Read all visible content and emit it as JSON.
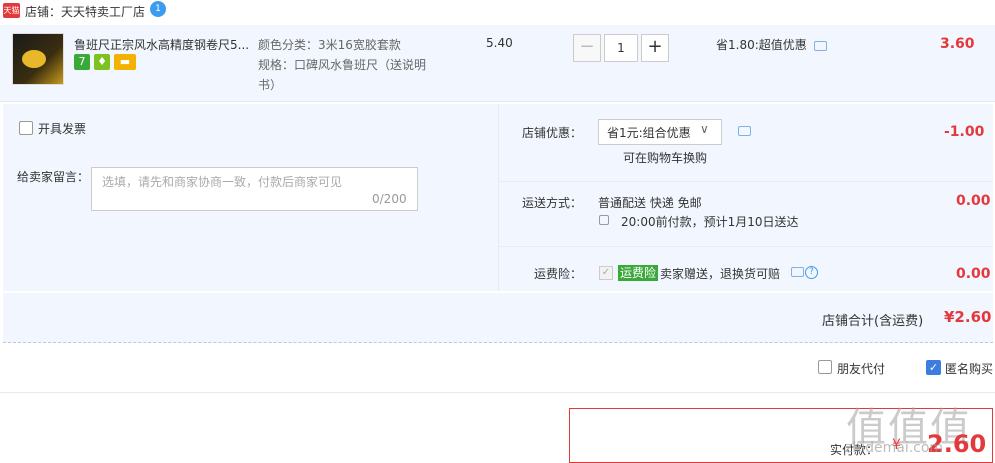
{
  "shop": {
    "logo_text": "天猫",
    "label": "店铺：天天特卖工厂店",
    "badge": "1"
  },
  "item": {
    "title": "鲁班尺正宗风水高精度钢卷尺5...",
    "tags": [
      "7",
      "♦",
      "▬"
    ],
    "attr_color": "颜色分类：3米16宽胶套款",
    "attr_spec_1": "规格：口碑风水鲁班尺（送说明",
    "attr_spec_2": "书）",
    "unit_price": "5.40",
    "qty_minus": "−",
    "qty_value": "1",
    "qty_plus": "+",
    "discount": "省1.80:超值优惠",
    "price": "3.60"
  },
  "invoice": {
    "label": "开具发票"
  },
  "message": {
    "label": "给卖家留言：",
    "placeholder": "选填，请先和商家协商一致，付款后商家可见",
    "count": "0/200"
  },
  "shop_discount": {
    "label": "店铺优惠：",
    "selected": "省1元:组合优惠",
    "note": "可在购物车换购",
    "value": "-1.00"
  },
  "shipping": {
    "label": "运送方式：",
    "method": "普通配送 快递 免邮",
    "eta": "20:00前付款，预计1月10日送达",
    "value": "0.00"
  },
  "insurance": {
    "label": "运费险：",
    "tag": "运费险",
    "desc": "卖家赠送，退换货可赔",
    "value": "0.00"
  },
  "shop_total": {
    "label": "店铺合计(含运费)",
    "value": "¥2.60"
  },
  "options": {
    "friend_pay": "朋友代付",
    "anonymous": "匿名购买"
  },
  "payment": {
    "label": "实付款：",
    "currency": "¥",
    "value": "2.60"
  },
  "watermark": {
    "main": "值值值",
    "sub": "zhidemai.com"
  }
}
